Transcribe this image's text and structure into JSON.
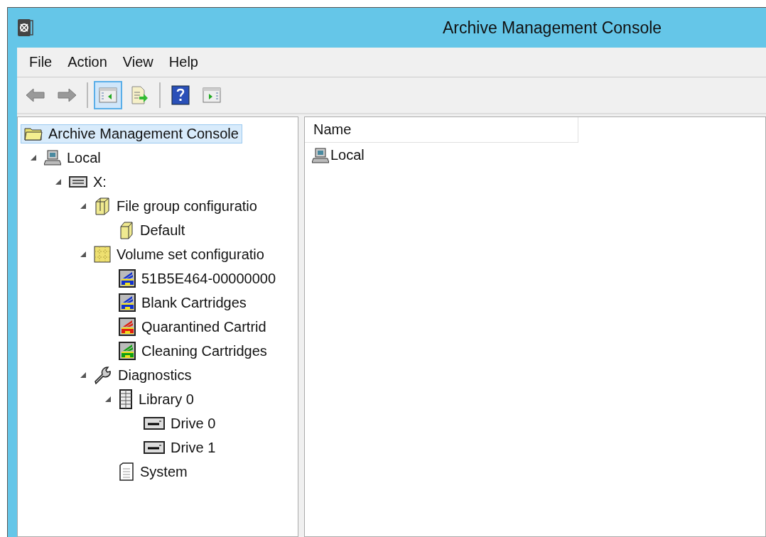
{
  "window": {
    "title": "Archive Management Console"
  },
  "menu": [
    "File",
    "Action",
    "View",
    "Help"
  ],
  "toolbar": [
    {
      "kind": "back",
      "pressed": false
    },
    {
      "kind": "forward",
      "pressed": false
    },
    {
      "kind": "separator"
    },
    {
      "kind": "tree-toggle",
      "pressed": true
    },
    {
      "kind": "export",
      "pressed": false
    },
    {
      "kind": "separator"
    },
    {
      "kind": "help",
      "pressed": false
    },
    {
      "kind": "action-pane",
      "pressed": false
    }
  ],
  "tree": [
    {
      "label": "Archive Management Console",
      "kind": "folder",
      "selected": true,
      "children": [
        {
          "label": "Local",
          "kind": "computer",
          "selected": false,
          "expanded": true,
          "children": [
            {
              "label": "X:",
              "kind": "drive",
              "selected": false,
              "expanded": true,
              "children": [
                {
                  "label": "File group configuratio",
                  "kind": "filegroup",
                  "selected": false,
                  "expanded": true,
                  "children": [
                    {
                      "label": "Default",
                      "kind": "filegroup-item",
                      "selected": false
                    }
                  ]
                },
                {
                  "label": "Volume set configuratio",
                  "kind": "volumeset",
                  "selected": false,
                  "expanded": true,
                  "children": [
                    {
                      "label": "51B5E464-00000000",
                      "kind": "cartridge",
                      "color": "#1030d0",
                      "selected": false
                    },
                    {
                      "label": "Blank Cartridges",
                      "kind": "cartridge",
                      "color": "#1030d0",
                      "selected": false
                    },
                    {
                      "label": "Quarantined Cartrid",
                      "kind": "cartridge",
                      "color": "#e02010",
                      "selected": false
                    },
                    {
                      "label": "Cleaning Cartridges",
                      "kind": "cartridge",
                      "color": "#10a010",
                      "selected": false
                    }
                  ]
                },
                {
                  "label": "Diagnostics",
                  "kind": "wrench",
                  "selected": false,
                  "expanded": true,
                  "children": [
                    {
                      "label": "Library 0",
                      "kind": "library",
                      "selected": false,
                      "expanded": true,
                      "children": [
                        {
                          "label": "Drive 0",
                          "kind": "tapedrive",
                          "selected": false
                        },
                        {
                          "label": "Drive 1",
                          "kind": "tapedrive",
                          "selected": false
                        }
                      ]
                    },
                    {
                      "label": "System",
                      "kind": "document",
                      "selected": false
                    }
                  ]
                }
              ]
            }
          ]
        }
      ]
    }
  ],
  "list": {
    "columns": [
      "Name"
    ],
    "rows": [
      {
        "name": "Local",
        "kind": "computer"
      }
    ]
  }
}
